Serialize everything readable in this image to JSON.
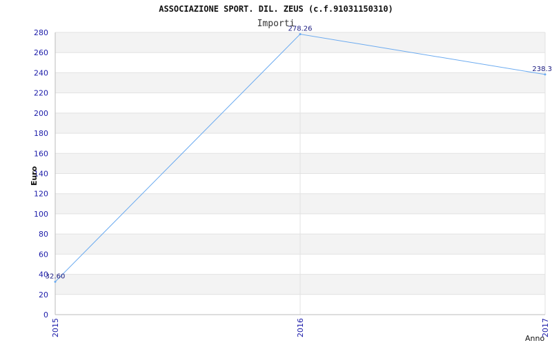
{
  "chart_data": {
    "type": "line",
    "title": "ASSOCIAZIONE SPORT. DIL. ZEUS (c.f.91031150310)",
    "subtitle": "Importi",
    "xlabel": "Anno",
    "ylabel": "Euro",
    "categories": [
      "2015",
      "2016",
      "2017"
    ],
    "series": [
      {
        "values": [
          32.6,
          278.26,
          238.3
        ],
        "labels": [
          "32.60",
          "278.26",
          "238.3"
        ]
      }
    ],
    "ylim": [
      0,
      280
    ],
    "yticks": [
      0,
      20,
      40,
      60,
      80,
      100,
      120,
      140,
      160,
      180,
      200,
      220,
      240,
      260,
      280
    ],
    "grid": true,
    "colors": {
      "line": "#6aaaf0",
      "band": "#f3f3f3",
      "tick": "#1a1aa8"
    }
  }
}
